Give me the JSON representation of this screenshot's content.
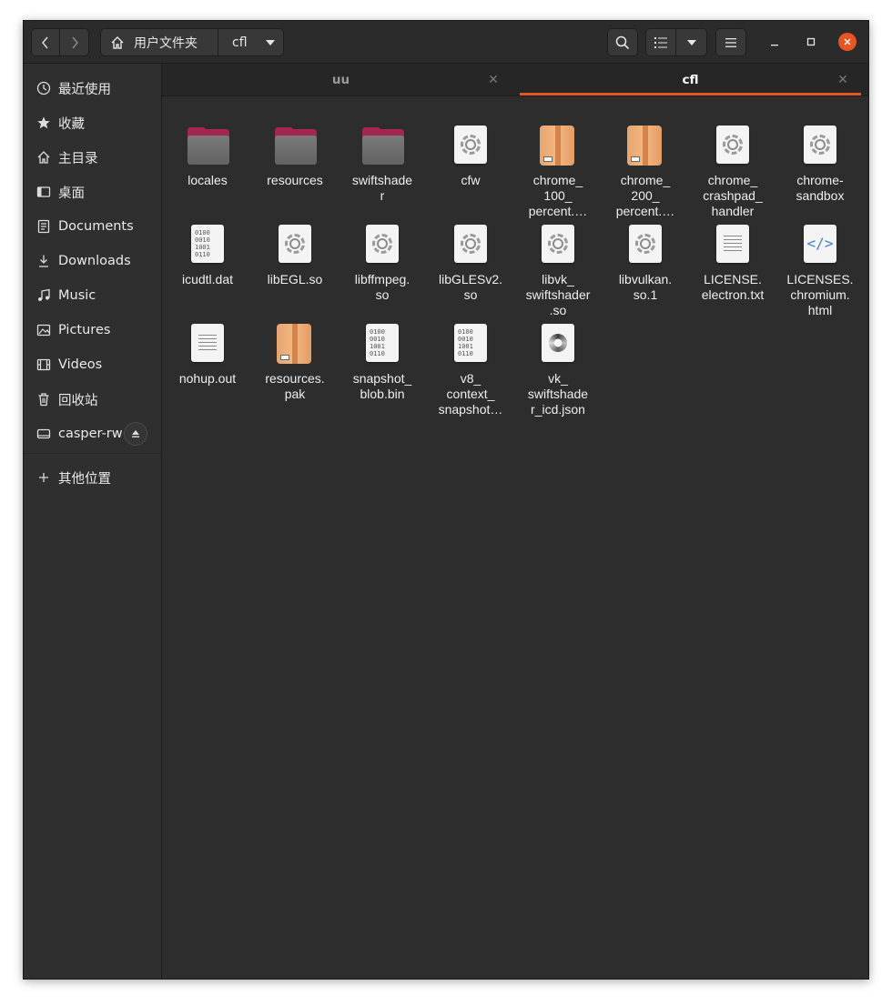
{
  "pathbar": {
    "home_label": "用户文件夹",
    "current_label": "cfl"
  },
  "sidebar": {
    "items": [
      {
        "label": "最近使用",
        "icon": "recent-icon"
      },
      {
        "label": "收藏",
        "icon": "star-icon"
      },
      {
        "label": "主目录",
        "icon": "home-icon"
      },
      {
        "label": "桌面",
        "icon": "desktop-icon"
      },
      {
        "label": "Documents",
        "icon": "documents-icon"
      },
      {
        "label": "Downloads",
        "icon": "downloads-icon"
      },
      {
        "label": "Music",
        "icon": "music-icon"
      },
      {
        "label": "Pictures",
        "icon": "pictures-icon"
      },
      {
        "label": "Videos",
        "icon": "videos-icon"
      },
      {
        "label": "回收站",
        "icon": "trash-icon"
      },
      {
        "label": "casper-rw",
        "icon": "drive-icon"
      },
      {
        "label": "其他位置",
        "icon": "plus-icon"
      }
    ]
  },
  "tabs": [
    {
      "label": "uu",
      "active": false
    },
    {
      "label": "cfl",
      "active": true
    }
  ],
  "files": [
    {
      "name": "locales",
      "type": "folder"
    },
    {
      "name": "resources",
      "type": "folder"
    },
    {
      "name": "swiftshade\nr",
      "type": "folder"
    },
    {
      "name": "cfw",
      "type": "executable"
    },
    {
      "name": "chrome_\n100_\npercent.…",
      "type": "package"
    },
    {
      "name": "chrome_\n200_\npercent.…",
      "type": "package"
    },
    {
      "name": "chrome_\ncrashpad_\nhandler",
      "type": "executable"
    },
    {
      "name": "chrome-\nsandbox",
      "type": "executable"
    },
    {
      "name": "icudtl.dat",
      "type": "binary"
    },
    {
      "name": "libEGL.so",
      "type": "executable"
    },
    {
      "name": "libffmpeg.\nso",
      "type": "executable"
    },
    {
      "name": "libGLESv2.\nso",
      "type": "executable"
    },
    {
      "name": "libvk_\nswiftshader\n.so",
      "type": "executable"
    },
    {
      "name": "libvulkan.\nso.1",
      "type": "executable"
    },
    {
      "name": "LICENSE.\nelectron.txt",
      "type": "text"
    },
    {
      "name": "LICENSES.\nchromium.\nhtml",
      "type": "html"
    },
    {
      "name": "nohup.out",
      "type": "text"
    },
    {
      "name": "resources.\npak",
      "type": "package"
    },
    {
      "name": "snapshot_\nblob.bin",
      "type": "binary"
    },
    {
      "name": "v8_\ncontext_\nsnapshot…",
      "type": "binary"
    },
    {
      "name": "vk_\nswiftshade\nr_icd.json",
      "type": "json"
    }
  ],
  "binary_glyph": "0100\n0010\n1001\n0110",
  "html_glyph": "</>",
  "colors": {
    "accent": "#e95420",
    "folder_tab": "#a5274f",
    "background": "#2d2d2d"
  }
}
